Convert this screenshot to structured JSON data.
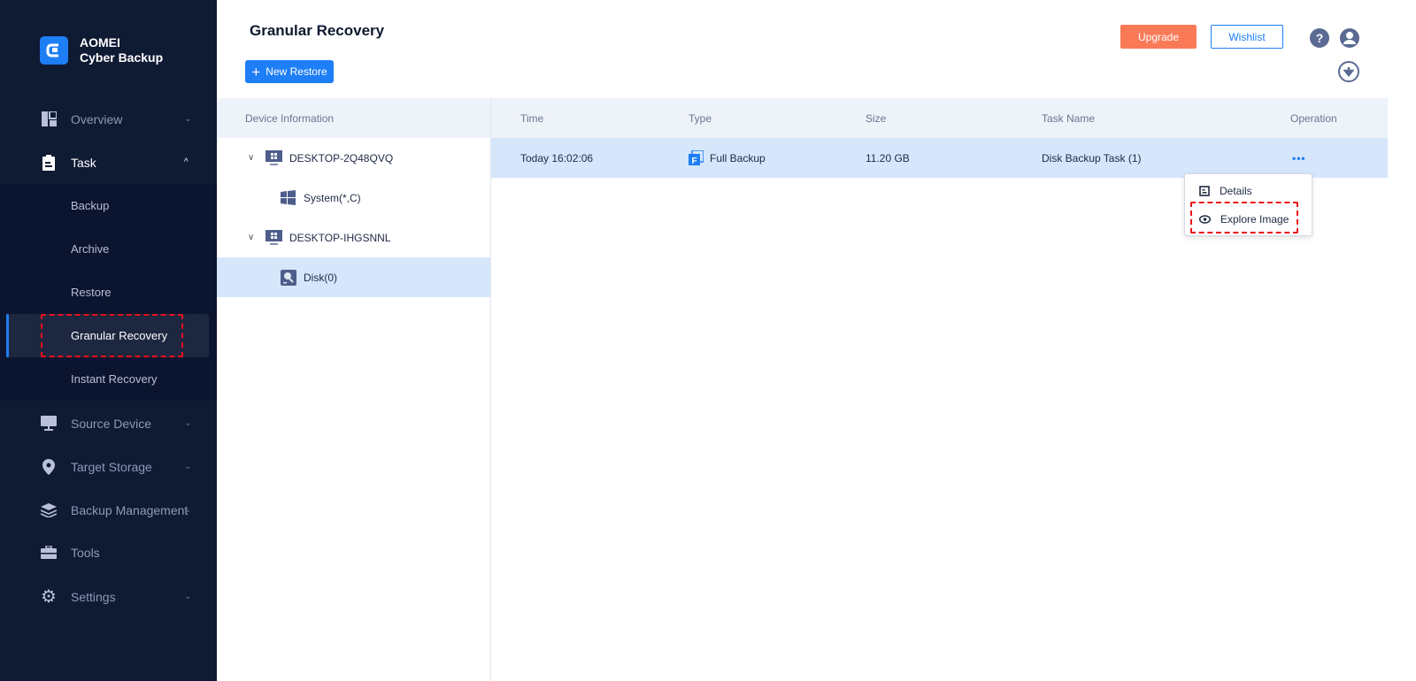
{
  "app": {
    "brand_line1": "AOMEI",
    "brand_line2": "Cyber Backup"
  },
  "sidebar": {
    "overview": "Overview",
    "task": "Task",
    "task_sub": [
      "Backup",
      "Archive",
      "Restore",
      "Granular Recovery",
      "Instant Recovery"
    ],
    "source_device": "Source Device",
    "target_storage": "Target Storage",
    "backup_management": "Backup Management",
    "tools": "Tools",
    "settings": "Settings"
  },
  "header": {
    "title": "Granular Recovery",
    "new_restore": "New Restore",
    "upgrade": "Upgrade",
    "wishlist": "Wishlist"
  },
  "left_panel": {
    "header": "Device Information",
    "items": [
      {
        "label": "DESKTOP-2Q48QVQ",
        "icon": "windows-monitor-icon"
      },
      {
        "label": "System(*,C)",
        "icon": "windows-icon"
      },
      {
        "label": "DESKTOP-IHGSNNL",
        "icon": "windows-monitor-icon"
      },
      {
        "label": "Disk(0)",
        "icon": "disk-icon"
      }
    ]
  },
  "table": {
    "columns": [
      "Time",
      "Type",
      "Size",
      "Task Name",
      "Operation"
    ],
    "rows": [
      {
        "time": "Today 16:02:06",
        "type": "Full Backup",
        "size": "11.20 GB",
        "task_name": "Disk Backup Task (1)",
        "operation": "•••"
      }
    ]
  },
  "context_menu": {
    "details": "Details",
    "explore_image": "Explore Image"
  },
  "colors": {
    "accent": "#1e7ef5",
    "upgrade": "#fa7a58",
    "sidebar": "#0f1a33",
    "highlight": "#e8101a"
  }
}
